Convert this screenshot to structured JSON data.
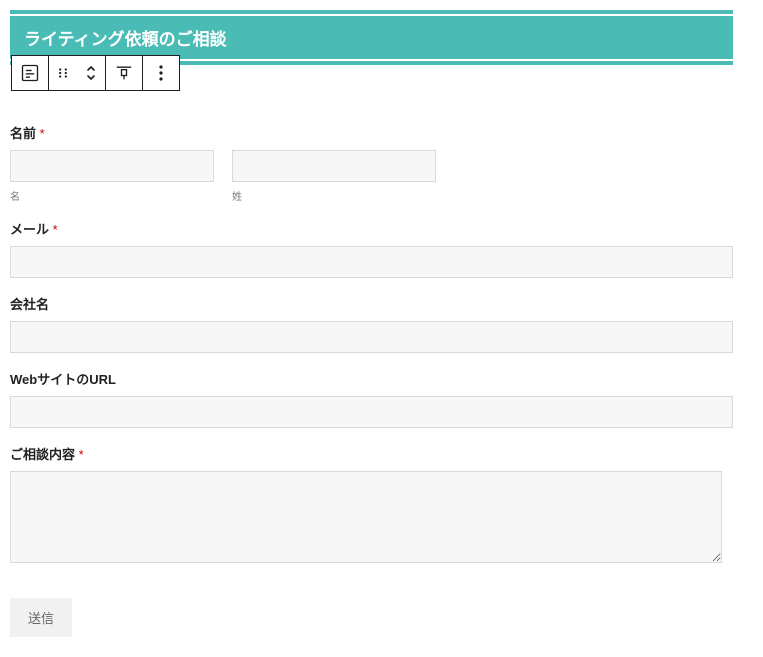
{
  "heading": {
    "title": "ライティング依頼のご相談"
  },
  "form": {
    "name": {
      "label": "名前",
      "required_mark": "*",
      "first_sub": "名",
      "last_sub": "姓"
    },
    "email": {
      "label": "メール",
      "required_mark": "*"
    },
    "company": {
      "label": "会社名"
    },
    "website": {
      "label": "WebサイトのURL"
    },
    "message": {
      "label": "ご相談内容",
      "required_mark": "*"
    },
    "submit_label": "送信"
  }
}
